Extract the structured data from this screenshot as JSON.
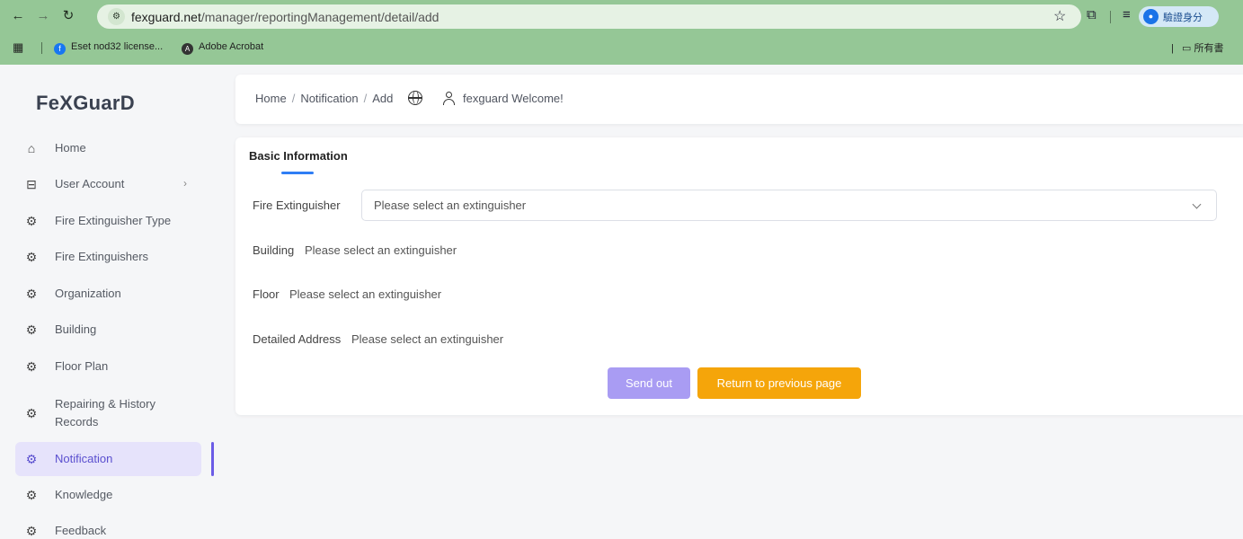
{
  "browser": {
    "url_host": "fexguard.net",
    "url_path": "/manager/reportingManagement/detail/add",
    "profile_label": "驗證身分",
    "bookmarks": [
      {
        "label": "Eset nod32 license..."
      },
      {
        "label": "Adobe Acrobat"
      }
    ],
    "bookmarks_right_label": "所有書"
  },
  "sidebar": {
    "logo": "FeXGuarD",
    "items": [
      {
        "label": "Home",
        "icon": "home-icon"
      },
      {
        "label": "User Account",
        "icon": "table-icon"
      },
      {
        "label": "Fire Extinguisher Type",
        "icon": "gear-icon"
      },
      {
        "label": "Fire Extinguishers",
        "icon": "gear-icon"
      },
      {
        "label": "Organization",
        "icon": "gear-icon"
      },
      {
        "label": "Building",
        "icon": "gear-icon"
      },
      {
        "label": "Floor Plan",
        "icon": "gear-icon"
      },
      {
        "label": "Repairing & History Records",
        "icon": "gear-icon"
      },
      {
        "label": "Notification",
        "icon": "gear-icon",
        "active": true
      },
      {
        "label": "Knowledge",
        "icon": "gear-icon"
      },
      {
        "label": "Feedback",
        "icon": "gear-icon"
      }
    ]
  },
  "header": {
    "breadcrumb": [
      "Home",
      "Notification",
      "Add"
    ],
    "welcome": "fexguard Welcome!"
  },
  "form": {
    "tab": "Basic Information",
    "fire_extinguisher_label": "Fire Extinguisher",
    "fire_extinguisher_placeholder": "Please select an extinguisher",
    "building_label": "Building",
    "building_value": "Please select an extinguisher",
    "floor_label": "Floor",
    "floor_value": "Please select an extinguisher",
    "address_label": "Detailed Address",
    "address_value": "Please select an extinguisher",
    "send_button": "Send out",
    "return_button": "Return to previous page"
  },
  "colors": {
    "accent": "#6b5ce7",
    "send_button": "#a99cf3",
    "return_button": "#f5a50a",
    "tab_underline": "#2f7ef5",
    "browser_frame": "#95c796"
  }
}
